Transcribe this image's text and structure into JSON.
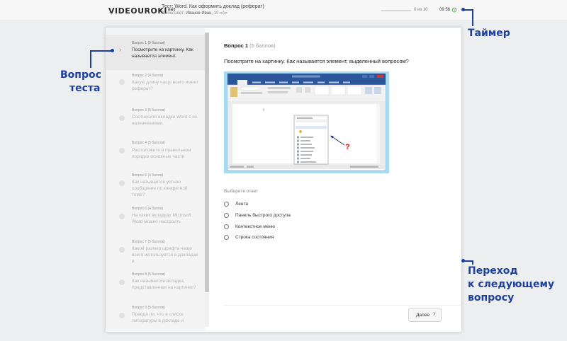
{
  "header": {
    "logo": "VIDEOUROKI",
    "logo_sup": "net",
    "test_title": "Тест: Word. Как оформить доклад (реферат)",
    "performer_label": "Выполняет:",
    "performer_name": "Иванов Иван",
    "performer_class": ", 10 «А»",
    "progress": "0 из 10",
    "progress_fraction": 0.0,
    "timer": "09 56",
    "timer_icon": "alarm-clock-icon"
  },
  "sidebar": {
    "items": [
      {
        "head": "Вопрос 1 (5 баллов)",
        "text": "Посмотрите на картинку. Как называется элемент."
      },
      {
        "head": "Вопрос 2 (4 балла)",
        "text": "Какую длину чаще всего имеет реферат?"
      },
      {
        "head": "Вопрос 3 (5 баллов)",
        "text": "Соотнесите вкладки Word с их назначениями."
      },
      {
        "head": "Вопрос 4 (5 баллов)",
        "text": "Расположите в правильном порядке основные части"
      },
      {
        "head": "Вопрос 5 (4 балла)",
        "text": "Как называется устное сообщение по конкретной теме?"
      },
      {
        "head": "Вопрос 6 (4 балла)",
        "text": "На каких вкладках Microsoft Word можно настроить"
      },
      {
        "head": "Вопрос 7 (5 баллов)",
        "text": "Какой размер шрифта чаще всего используется в докладах и"
      },
      {
        "head": "Вопрос 8 (5 баллов)",
        "text": "Как называется вкладка, представленная на картинке?"
      },
      {
        "head": "Вопрос 9 (5 баллов)",
        "text": "Правда ли, что в списке литературы в докладе и"
      }
    ]
  },
  "main": {
    "question_label": "Вопрос 1",
    "question_points": "(5 баллов)",
    "question_text": "Посмотрите на картинку. Как называется элемент, выделенный вопросом?",
    "answer_label": "Выберите ответ",
    "options": [
      "Лента",
      "Панель быстрого доступа",
      "Контекстное меню",
      "Строка состояния"
    ],
    "next_label": "Далее",
    "image_question_mark": "?"
  },
  "annotations": {
    "timer": "Таймер",
    "question_line1": "Вопрос",
    "question_line2": "теста",
    "next_line1": "Переход",
    "next_line2": "к следующему",
    "next_line3": "вопросу"
  },
  "colors": {
    "accent": "#1e3fa0",
    "progress": "#3a6fd1",
    "word_blue": "#2b579a"
  }
}
